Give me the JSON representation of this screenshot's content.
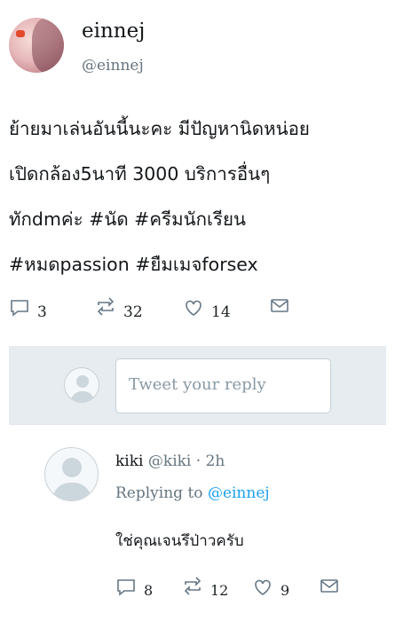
{
  "tweet": {
    "display_name": "einnej",
    "handle": "@einnej",
    "text_lines": [
      "ย้ายมาเล่นอันนี้นะคะ มีปัญหานิดหน่อย",
      "เปิดกล้อง5นาที 3000 บริการอื่นๆ",
      "ทักdmค่ะ #นัด #ครีมนักเรียน",
      "#หมดpassion #ยืมเมจforsex"
    ],
    "actions": {
      "reply_icon": "reply-icon",
      "reply_count": "3",
      "retweet_icon": "retweet-icon",
      "retweet_count": "32",
      "like_icon": "heart-icon",
      "like_count": "14",
      "dm_icon": "envelope-icon"
    }
  },
  "reply_box": {
    "placeholder": "Tweet your reply"
  },
  "reply": {
    "name": "kiki",
    "handle": "@kiki",
    "separator": "·",
    "time": "2h",
    "replying_prefix": "Replying to",
    "replying_to": "@einnej",
    "text": "ใช่คุณเจนรึป่าวครับ",
    "actions": {
      "reply_count": "8",
      "retweet_count": "12",
      "like_count": "9"
    }
  },
  "colors": {
    "link": "#1da1f2",
    "muted": "#66757f",
    "reply_bar_bg": "#e6ecf0"
  }
}
